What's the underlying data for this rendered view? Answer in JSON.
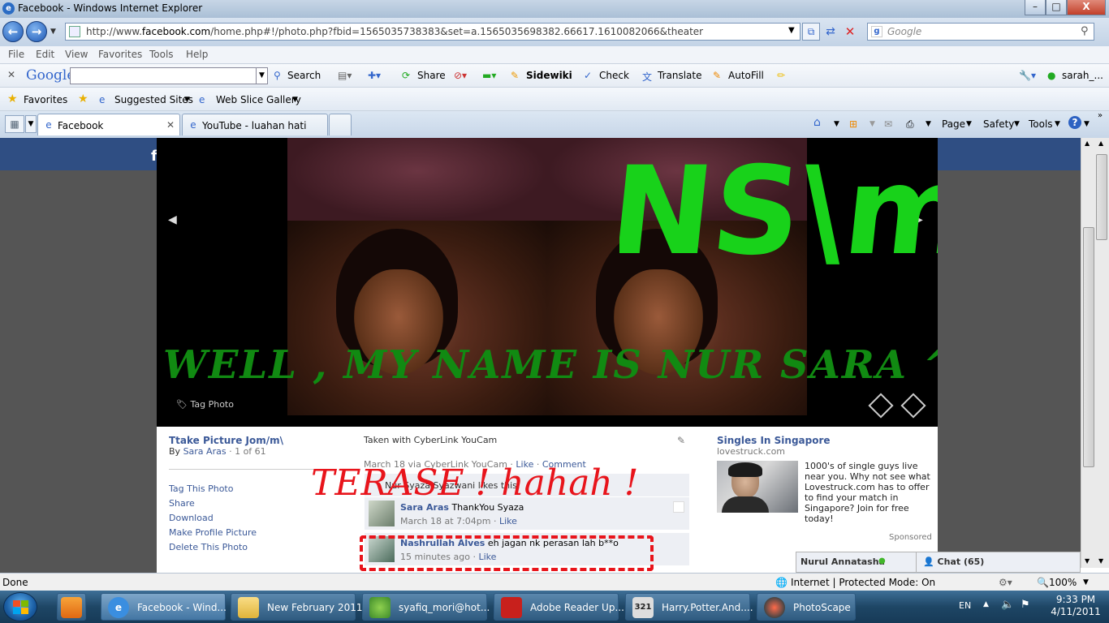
{
  "window": {
    "title": "Facebook - Windows Internet Explorer",
    "minimize": "–",
    "maximize": "□",
    "close": "X"
  },
  "address": {
    "url_pre": "http://www.",
    "url_domain": "facebook.com",
    "url_post": "/home.php#!/photo.php?fbid=1565035738383&set=a.1565035698382.66617.1610082066&theater",
    "search_placeholder": "Google"
  },
  "menu": [
    "File",
    "Edit",
    "View",
    "Favorites",
    "Tools",
    "Help"
  ],
  "google_toolbar": {
    "logo": "Google",
    "search": "Search",
    "share": "Share",
    "sidewiki": "Sidewiki",
    "check": "Check",
    "translate": "Translate",
    "autofill": "AutoFill",
    "user": "sarah_..."
  },
  "favorites": {
    "label": "Favorites",
    "suggested": "Suggested Sites",
    "webslice": "Web Slice Gallery"
  },
  "tabs": [
    {
      "label": "Facebook"
    },
    {
      "label": "YouTube - luahan hati"
    }
  ],
  "commandbar": {
    "page": "Page",
    "safety": "Safety",
    "tools": "Tools"
  },
  "photo": {
    "overlay_text": "NS\\m/",
    "caption_overlay": "WELL , MY NAME IS NUR SARA ^^,",
    "tag": "Tag Photo"
  },
  "album": {
    "title": "Ttake Picture Jom/m\\",
    "by": "By",
    "owner": "Sara Aras",
    "count": "1 of 61"
  },
  "actions": [
    "Tag This Photo",
    "Share",
    "Download",
    "Make Profile Picture",
    "Delete This Photo"
  ],
  "post": {
    "caption": "Taken with CyberLink YouCam",
    "meta": "March 18 via CyberLink YouCam",
    "like": "Like",
    "comment": "Comment",
    "likes_text": "Nur Syaza Syazwani likes this."
  },
  "comments": [
    {
      "name": "Sara Aras",
      "text": "ThankYou Syaza",
      "time": "March 18 at 7:04pm",
      "like": "Like"
    },
    {
      "name": "Nashrullah Alves",
      "text": "eh jagan nk perasan lah b**o",
      "time": "15 minutes ago",
      "like": "Like"
    }
  ],
  "annotation": "TERASE ! hahah !",
  "ad": {
    "title": "Singles In Singapore",
    "domain": "lovestruck.com",
    "body": "1000's of single guys live near you. Why not see what Lovestruck.com has to offer to find your match in Singapore? Join for free today!",
    "sponsored": "Sponsored"
  },
  "chat": {
    "friend": "Nurul Annatasha",
    "chat_label": "Chat (65)"
  },
  "status": {
    "left": "Done",
    "zone": "Internet | Protected Mode: On",
    "zoom": "100%"
  },
  "taskbar": {
    "items": [
      "Facebook - Wind...",
      "New February 2011",
      "syafiq_mori@hot...",
      "Adobe Reader Up...",
      "Harry.Potter.And....",
      "PhotoScape"
    ],
    "lang": "EN",
    "time": "9:33 PM",
    "date": "4/11/2011"
  }
}
